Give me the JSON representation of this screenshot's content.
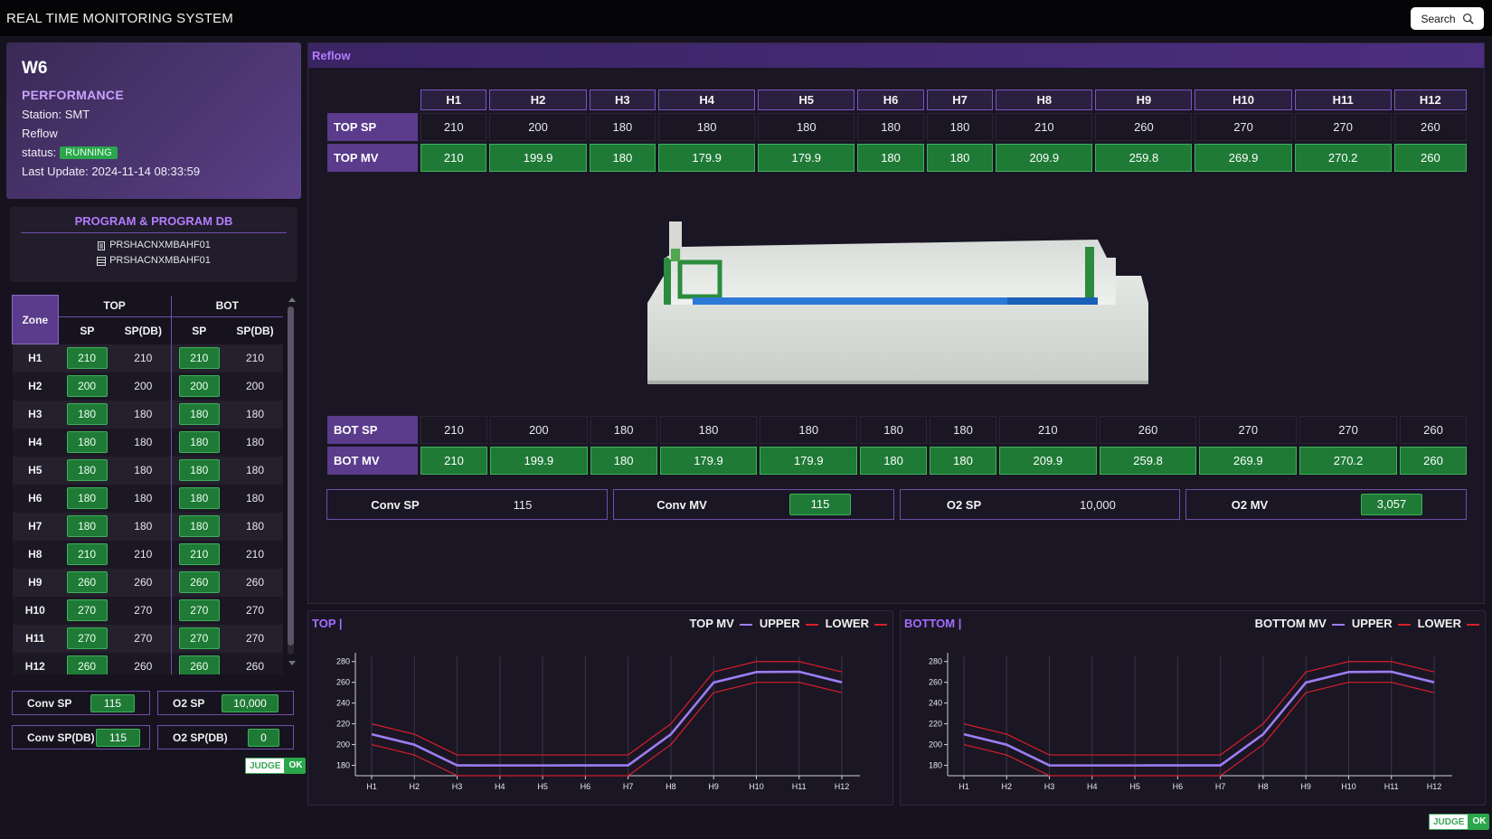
{
  "app": {
    "title": "REAL TIME MONITORING SYSTEM",
    "search_label": "Search"
  },
  "performance": {
    "machine": "W6",
    "title": "PERFORMANCE",
    "station": "Station: SMT",
    "process": "Reflow",
    "status_label": "status:",
    "status_value": "RUNNING",
    "last_update": "Last Update: 2024-11-14 08:33:59"
  },
  "program": {
    "title": "PROGRAM & PROGRAM DB",
    "items": [
      {
        "icon": "document-icon",
        "name": "PRSHACNXMBAHF01"
      },
      {
        "icon": "database-icon",
        "name": "PRSHACNXMBAHF01"
      }
    ]
  },
  "zone_table": {
    "zone_header": "Zone",
    "top_header": "TOP",
    "bot_header": "BOT",
    "sp_header": "SP",
    "spdb_header": "SP(DB)",
    "rows": [
      {
        "zone": "H1",
        "top_sp": "210",
        "top_spdb": "210",
        "bot_sp": "210",
        "bot_spdb": "210"
      },
      {
        "zone": "H2",
        "top_sp": "200",
        "top_spdb": "200",
        "bot_sp": "200",
        "bot_spdb": "200"
      },
      {
        "zone": "H3",
        "top_sp": "180",
        "top_spdb": "180",
        "bot_sp": "180",
        "bot_spdb": "180"
      },
      {
        "zone": "H4",
        "top_sp": "180",
        "top_spdb": "180",
        "bot_sp": "180",
        "bot_spdb": "180"
      },
      {
        "zone": "H5",
        "top_sp": "180",
        "top_spdb": "180",
        "bot_sp": "180",
        "bot_spdb": "180"
      },
      {
        "zone": "H6",
        "top_sp": "180",
        "top_spdb": "180",
        "bot_sp": "180",
        "bot_spdb": "180"
      },
      {
        "zone": "H7",
        "top_sp": "180",
        "top_spdb": "180",
        "bot_sp": "180",
        "bot_spdb": "180"
      },
      {
        "zone": "H8",
        "top_sp": "210",
        "top_spdb": "210",
        "bot_sp": "210",
        "bot_spdb": "210"
      },
      {
        "zone": "H9",
        "top_sp": "260",
        "top_spdb": "260",
        "bot_sp": "260",
        "bot_spdb": "260"
      },
      {
        "zone": "H10",
        "top_sp": "270",
        "top_spdb": "270",
        "bot_sp": "270",
        "bot_spdb": "270"
      },
      {
        "zone": "H11",
        "top_sp": "270",
        "top_spdb": "270",
        "bot_sp": "270",
        "bot_spdb": "270"
      },
      {
        "zone": "H12",
        "top_sp": "260",
        "top_spdb": "260",
        "bot_sp": "260",
        "bot_spdb": "260"
      }
    ]
  },
  "left_summary": {
    "conv_sp_label": "Conv SP",
    "conv_sp_value": "115",
    "o2_sp_label": "O2 SP",
    "o2_sp_value": "10,000",
    "conv_spdb_label": "Conv SP(DB)",
    "conv_spdb_value": "115",
    "o2_spdb_label": "O2 SP(DB)",
    "o2_spdb_value": "0",
    "judge_label": "JUDGE",
    "judge_value": "OK"
  },
  "reflow": {
    "header": "Reflow",
    "zones": [
      "H1",
      "H2",
      "H3",
      "H4",
      "H5",
      "H6",
      "H7",
      "H8",
      "H9",
      "H10",
      "H11",
      "H12"
    ],
    "top_sp_label": "TOP SP",
    "top_mv_label": "TOP MV",
    "bot_sp_label": "BOT SP",
    "bot_mv_label": "BOT MV",
    "top_sp": [
      "210",
      "200",
      "180",
      "180",
      "180",
      "180",
      "180",
      "210",
      "260",
      "270",
      "270",
      "260"
    ],
    "top_mv": [
      "210",
      "199.9",
      "180",
      "179.9",
      "179.9",
      "180",
      "180",
      "209.9",
      "259.8",
      "269.9",
      "270.2",
      "260"
    ],
    "bot_sp": [
      "210",
      "200",
      "180",
      "180",
      "180",
      "180",
      "180",
      "210",
      "260",
      "270",
      "270",
      "260"
    ],
    "bot_mv": [
      "210",
      "199.9",
      "180",
      "179.9",
      "179.9",
      "180",
      "180",
      "209.9",
      "259.8",
      "269.9",
      "270.2",
      "260"
    ],
    "conv_sp_label": "Conv SP",
    "conv_sp_value": "115",
    "conv_mv_label": "Conv MV",
    "conv_mv_value": "115",
    "o2_sp_label": "O2 SP",
    "o2_sp_value": "10,000",
    "o2_mv_label": "O2 MV",
    "o2_mv_value": "3,057"
  },
  "colors": {
    "mv_line": "#9d7df2",
    "limit_line": "#d81e2a",
    "ok_green": "#2aa64b",
    "accent_purple": "#b47bff"
  },
  "chart_data": [
    {
      "type": "line",
      "title": "TOP |",
      "categories": [
        "H1",
        "H2",
        "H3",
        "H4",
        "H5",
        "H6",
        "H7",
        "H8",
        "H9",
        "H10",
        "H11",
        "H12"
      ],
      "yticks": [
        180,
        200,
        220,
        240,
        260,
        280
      ],
      "ylim": [
        170,
        285
      ],
      "series": [
        {
          "name": "TOP MV",
          "color": "#9d7df2",
          "values": [
            210,
            199.9,
            180,
            179.9,
            179.9,
            180,
            180,
            209.9,
            259.8,
            269.9,
            270.2,
            260
          ]
        },
        {
          "name": "UPPER",
          "color": "#d81e2a",
          "values": [
            220,
            210,
            190,
            190,
            190,
            190,
            190,
            220,
            270,
            280,
            280,
            270
          ]
        },
        {
          "name": "LOWER",
          "color": "#d81e2a",
          "values": [
            200,
            190,
            170,
            170,
            170,
            170,
            170,
            200,
            250,
            260,
            260,
            250
          ]
        }
      ]
    },
    {
      "type": "line",
      "title": "BOTTOM |",
      "categories": [
        "H1",
        "H2",
        "H3",
        "H4",
        "H5",
        "H6",
        "H7",
        "H8",
        "H9",
        "H10",
        "H11",
        "H12"
      ],
      "yticks": [
        180,
        200,
        220,
        240,
        260,
        280
      ],
      "ylim": [
        170,
        285
      ],
      "series": [
        {
          "name": "BOTTOM MV",
          "color": "#9d7df2",
          "values": [
            210,
            199.9,
            180,
            179.9,
            179.9,
            180,
            180,
            209.9,
            259.8,
            269.9,
            270.2,
            260
          ]
        },
        {
          "name": "UPPER",
          "color": "#d81e2a",
          "values": [
            220,
            210,
            190,
            190,
            190,
            190,
            190,
            220,
            270,
            280,
            280,
            270
          ]
        },
        {
          "name": "LOWER",
          "color": "#d81e2a",
          "values": [
            200,
            190,
            170,
            170,
            170,
            170,
            170,
            200,
            250,
            260,
            260,
            250
          ]
        }
      ]
    }
  ],
  "footer": {
    "judge_label": "JUDGE",
    "judge_value": "OK"
  }
}
